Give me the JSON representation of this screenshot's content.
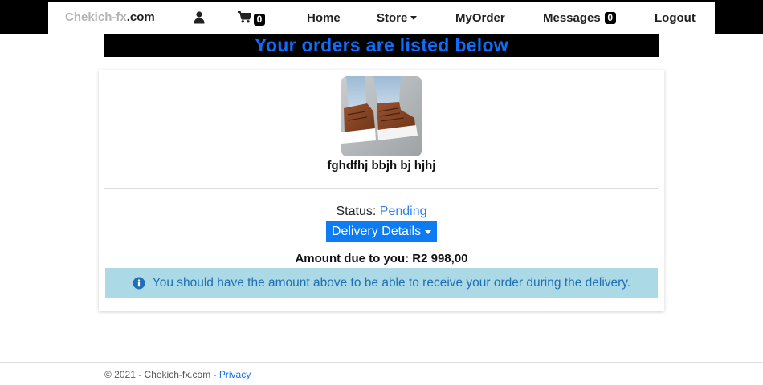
{
  "navbar": {
    "brand_part1": "Chekich-fx",
    "brand_part2": ".com",
    "user_icon": "user-icon",
    "cart_icon": "cart-icon",
    "cart_count": "0",
    "home_label": "Home",
    "store_label": "Store",
    "myorder_label": "MyOrder",
    "messages_label": "Messages",
    "messages_count": "0",
    "logout_label": "Logout"
  },
  "banner": {
    "title": "Your orders are listed below",
    "title_color": "#0d6efd"
  },
  "order": {
    "product_name": "fghdfhj bbjh bj hjhj",
    "status_label": "Status:",
    "status_value": "Pending",
    "delivery_button_label": "Delivery Details",
    "amount_text": "Amount due to you: R2 998,00",
    "info_icon": "info-circle-icon",
    "notice": "You should have the amount above to be able to receive your order during the delivery."
  },
  "colors": {
    "primary": "#0d7bf2",
    "alert_bg": "#abd9e6",
    "alert_text": "#1f6fb5",
    "navbar_bg": "#000000"
  },
  "footer": {
    "copyright": "© 2021 - Chekich-fx.com - ",
    "privacy_label": "Privacy"
  }
}
